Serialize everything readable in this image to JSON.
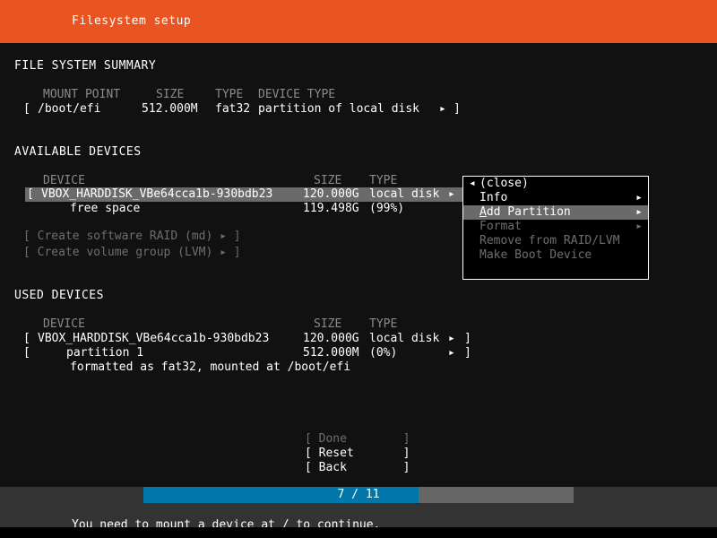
{
  "header": {
    "title": "Filesystem setup",
    "accent_color": "#e95420"
  },
  "filesystem_summary": {
    "section_title": "FILE SYSTEM SUMMARY",
    "columns": {
      "mount_point": "MOUNT POINT",
      "size": "SIZE",
      "type": "TYPE",
      "device_type": "DEVICE TYPE"
    },
    "rows": [
      {
        "bracket_open": "[",
        "mount_point": "/boot/efi",
        "size": "512.000M",
        "type": "fat32",
        "device_type": "partition of local disk",
        "arrow": "▸",
        "bracket_close": "]"
      }
    ]
  },
  "available_devices": {
    "section_title": "AVAILABLE DEVICES",
    "columns": {
      "device": "DEVICE",
      "size": "SIZE",
      "type": "TYPE"
    },
    "rows": [
      {
        "bracket_open": "[",
        "device": "VBOX_HARDDISK_VBe64cca1b-930bdb23",
        "size": "120.000G",
        "type": "local disk",
        "arrow": "▸",
        "bracket_close": "]",
        "selected": true
      },
      {
        "device": "free space",
        "size": "119.498G",
        "type": "(99%)",
        "selected": false
      }
    ],
    "actions": [
      {
        "label": "[ Create software RAID (md) ▸ ]",
        "enabled": false
      },
      {
        "label": "[ Create volume group (LVM) ▸ ]",
        "enabled": false
      }
    ]
  },
  "device_menu": {
    "items": [
      {
        "label": "(close)",
        "enabled": true,
        "active": false,
        "submenu": false,
        "back_arrow": "◂"
      },
      {
        "label": "Info",
        "enabled": true,
        "active": false,
        "submenu": true
      },
      {
        "label": "Add Partition",
        "hotkey": "A",
        "label_rest": "dd Partition",
        "enabled": true,
        "active": true,
        "submenu": true
      },
      {
        "label": "Format",
        "enabled": false,
        "active": false,
        "submenu": true
      },
      {
        "label": "Remove from RAID/LVM",
        "enabled": false,
        "active": false,
        "submenu": false
      },
      {
        "label": "Make Boot Device",
        "enabled": false,
        "active": false,
        "submenu": false
      }
    ],
    "submenu_arrow": "▸"
  },
  "used_devices": {
    "section_title": "USED DEVICES",
    "columns": {
      "device": "DEVICE",
      "size": "SIZE",
      "type": "TYPE"
    },
    "rows": [
      {
        "bracket_open": "[",
        "device": "VBOX_HARDDISK_VBe64cca1b-930bdb23",
        "size": "120.000G",
        "type": "local disk",
        "arrow": "▸",
        "bracket_close": "]"
      },
      {
        "bracket_open": "[",
        "device": "partition 1",
        "size": "512.000M",
        "type": "(0%)",
        "arrow": "▸",
        "bracket_close": "]"
      }
    ],
    "detail": "formatted as fat32, mounted at /boot/efi"
  },
  "buttons": [
    {
      "label": "[ Done        ]",
      "enabled": false
    },
    {
      "label": "[ Reset       ]",
      "enabled": true
    },
    {
      "label": "[ Back        ]",
      "enabled": true
    }
  ],
  "progress": {
    "label": "7 / 11",
    "current": 7,
    "total": 11,
    "percent": 64,
    "fill_color": "#0077a8",
    "track_color": "#666666"
  },
  "footer": {
    "message": "You need to mount a device at / to continue."
  }
}
